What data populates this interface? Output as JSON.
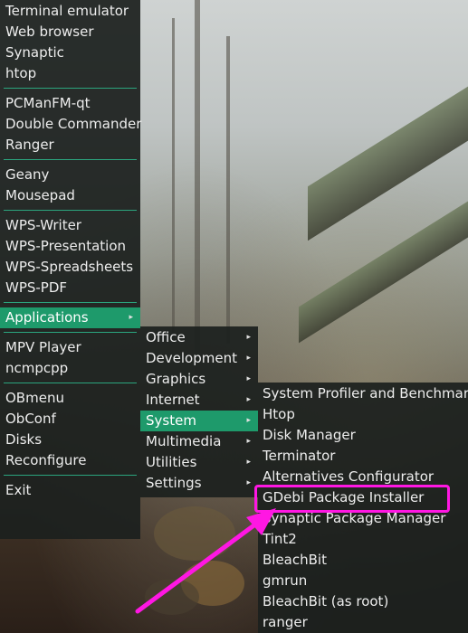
{
  "main_menu": {
    "groups": [
      [
        "Terminal emulator",
        "Web browser",
        "Synaptic",
        "htop"
      ],
      [
        "PCManFM-qt",
        "Double Commander",
        "Ranger"
      ],
      [
        "Geany",
        "Mousepad"
      ],
      [
        "WPS-Writer",
        "WPS-Presentation",
        "WPS-Spreadsheets",
        "WPS-PDF"
      ],
      [
        "Applications"
      ],
      [
        "MPV Player",
        "ncmpcpp"
      ],
      [
        "OBmenu",
        "ObConf",
        "Disks",
        "Reconfigure"
      ],
      [
        "Exit"
      ]
    ],
    "submenu_arrow": "▸"
  },
  "applications_menu": {
    "items": [
      "Office",
      "Development",
      "Graphics",
      "Internet",
      "System",
      "Multimedia",
      "Utilities",
      "Settings"
    ],
    "active": "System"
  },
  "system_menu": {
    "items": [
      "System Profiler and Benchmark",
      "Htop",
      "Disk Manager",
      "Terminator",
      "Alternatives Configurator",
      "GDebi Package Installer",
      "Synaptic Package Manager",
      "Tint2",
      "BleachBit",
      "gmrun",
      "BleachBit (as root)",
      "ranger"
    ],
    "highlighted": "GDebi Package Installer"
  },
  "annotation": {
    "color": "#ff17e3"
  }
}
